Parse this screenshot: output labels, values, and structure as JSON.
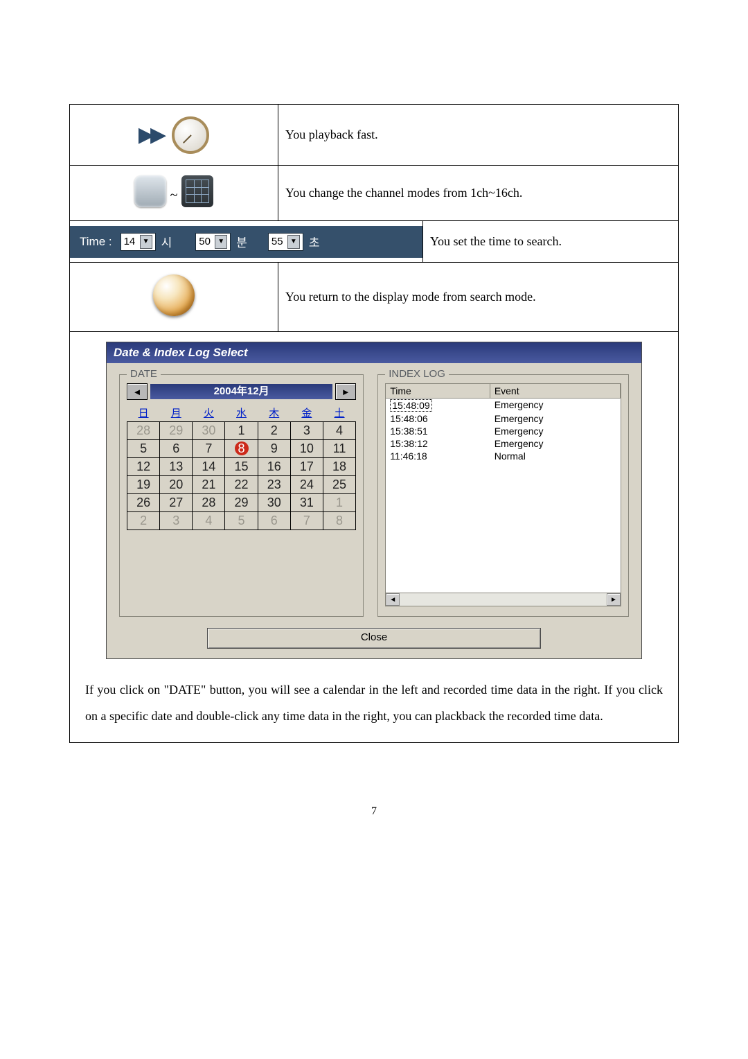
{
  "rows": {
    "fast_desc": "You playback fast.",
    "channel_desc": "You change the channel modes from 1ch~16ch.",
    "return_desc": "You return to the display mode from search mode."
  },
  "time_bar": {
    "label": "Time :",
    "hour": "14",
    "hour_unit": "시",
    "minute": "50",
    "minute_unit": "분",
    "second": "55",
    "second_unit": "초",
    "desc": "You set the time to search."
  },
  "dialog": {
    "title": "Date & Index Log Select",
    "date_label": "DATE",
    "indexlog_label": "INDEX LOG",
    "close": "Close",
    "calendar": {
      "title": "2004年12月",
      "dow": [
        "日",
        "月",
        "火",
        "水",
        "木",
        "金",
        "土"
      ],
      "weeks": [
        [
          {
            "d": "28",
            "o": true
          },
          {
            "d": "29",
            "o": true
          },
          {
            "d": "30",
            "o": true
          },
          {
            "d": "1"
          },
          {
            "d": "2"
          },
          {
            "d": "3"
          },
          {
            "d": "4"
          }
        ],
        [
          {
            "d": "5"
          },
          {
            "d": "6"
          },
          {
            "d": "7"
          },
          {
            "d": "8",
            "today": true
          },
          {
            "d": "9"
          },
          {
            "d": "10"
          },
          {
            "d": "11"
          }
        ],
        [
          {
            "d": "12"
          },
          {
            "d": "13"
          },
          {
            "d": "14"
          },
          {
            "d": "15"
          },
          {
            "d": "16"
          },
          {
            "d": "17"
          },
          {
            "d": "18"
          }
        ],
        [
          {
            "d": "19"
          },
          {
            "d": "20"
          },
          {
            "d": "21"
          },
          {
            "d": "22"
          },
          {
            "d": "23"
          },
          {
            "d": "24"
          },
          {
            "d": "25"
          }
        ],
        [
          {
            "d": "26"
          },
          {
            "d": "27"
          },
          {
            "d": "28"
          },
          {
            "d": "29"
          },
          {
            "d": "30"
          },
          {
            "d": "31"
          },
          {
            "d": "1",
            "o": true
          }
        ],
        [
          {
            "d": "2",
            "o": true
          },
          {
            "d": "3",
            "o": true
          },
          {
            "d": "4",
            "o": true
          },
          {
            "d": "5",
            "o": true
          },
          {
            "d": "6",
            "o": true
          },
          {
            "d": "7",
            "o": true
          },
          {
            "d": "8",
            "o": true
          }
        ]
      ]
    },
    "log": {
      "cols": {
        "time": "Time",
        "event": "Event"
      },
      "rows": [
        {
          "time": "15:48:09",
          "event": "Emergency",
          "selected": true
        },
        {
          "time": "15:48:06",
          "event": "Emergency"
        },
        {
          "time": "15:38:51",
          "event": "Emergency"
        },
        {
          "time": "15:38:12",
          "event": "Emergency"
        },
        {
          "time": "11:46:18",
          "event": "Normal"
        }
      ]
    }
  },
  "caption": "If you click on \"DATE\" button, you will see a calendar in the left and recorded time data in the right. If you click on a specific date and double-click any time data in the right, you can plackback the recorded time data.",
  "page_number": "7"
}
